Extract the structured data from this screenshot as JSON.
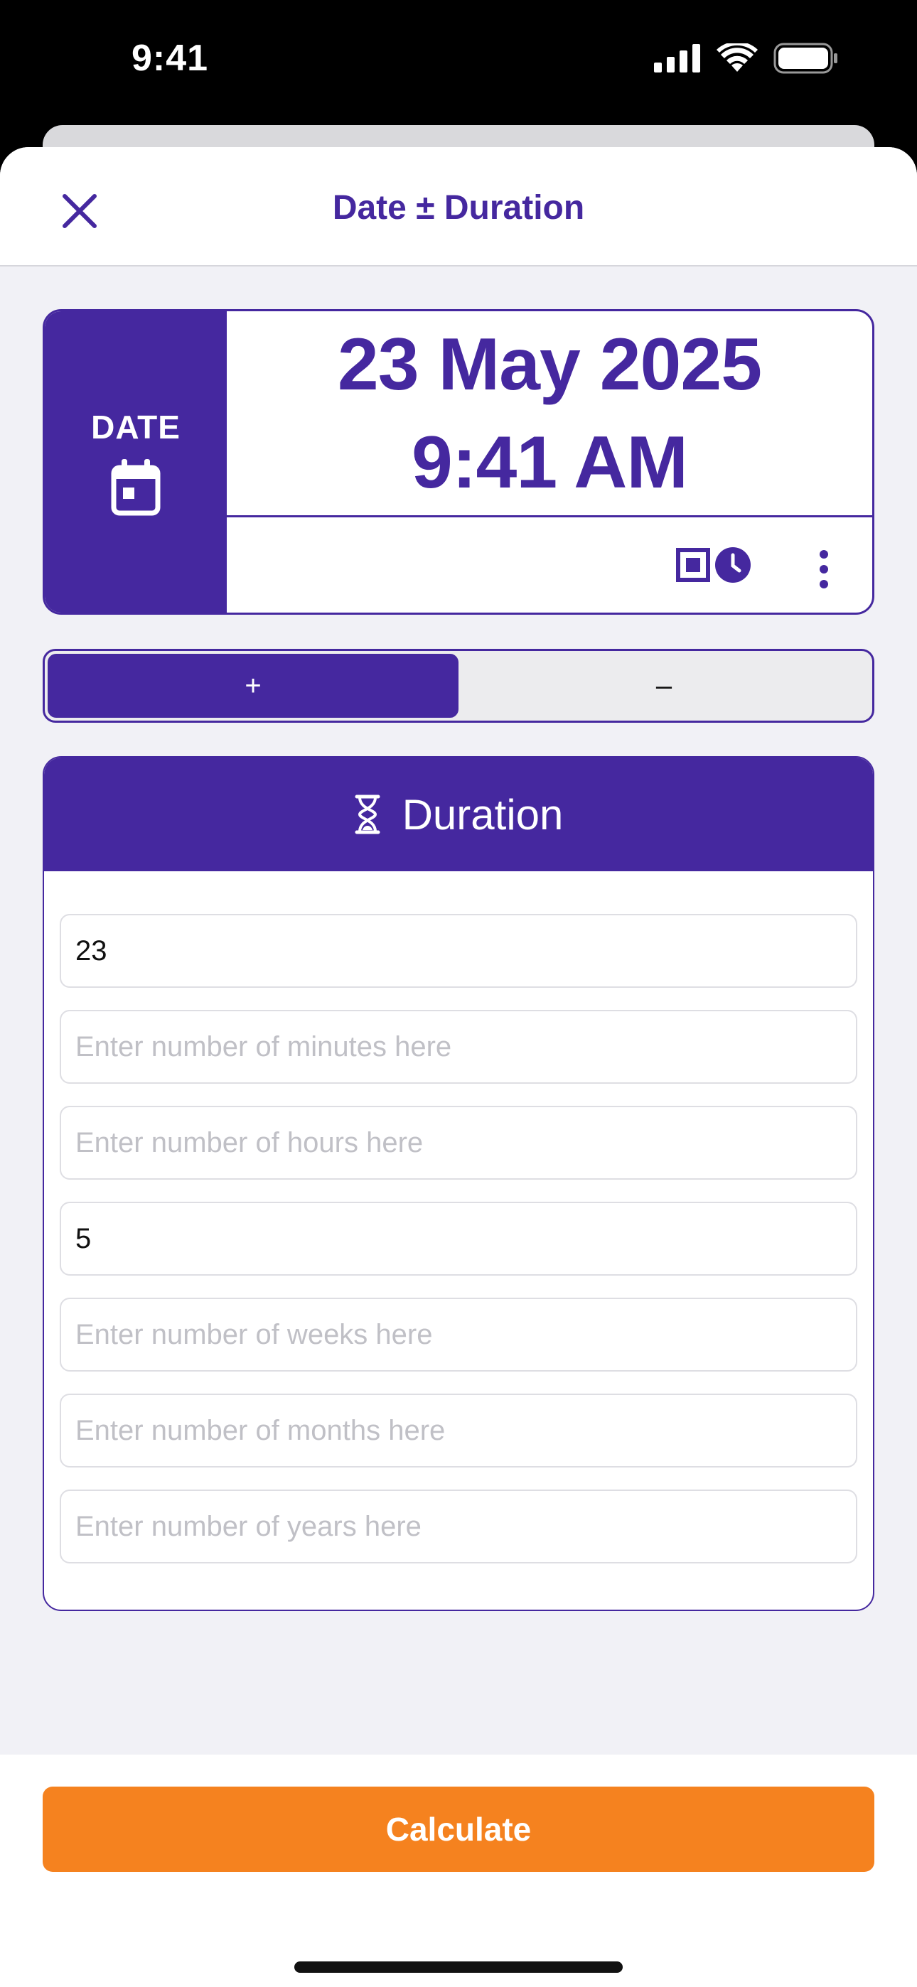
{
  "status_bar": {
    "time": "9:41"
  },
  "nav": {
    "title": "Date ± Duration"
  },
  "date_card": {
    "side_label": "DATE",
    "date_line": "23 May 2025",
    "time_line": "9:41 AM"
  },
  "operation": {
    "plus_label": "+",
    "minus_label": "–",
    "selected": "plus"
  },
  "duration": {
    "title": "Duration",
    "fields": [
      {
        "value": "23",
        "placeholder": ""
      },
      {
        "value": "",
        "placeholder": "Enter number of minutes here"
      },
      {
        "value": "",
        "placeholder": "Enter number of hours here"
      },
      {
        "value": "5",
        "placeholder": ""
      },
      {
        "value": "",
        "placeholder": "Enter number of weeks here"
      },
      {
        "value": "",
        "placeholder": "Enter number of months here"
      },
      {
        "value": "",
        "placeholder": "Enter number of years here"
      }
    ]
  },
  "actions": {
    "calculate_label": "Calculate"
  },
  "colors": {
    "primary": "#45289f",
    "accent": "#f5821f",
    "background": "#f1f1f6"
  },
  "icons": {
    "close": "close-icon",
    "calendar": "calendar-icon",
    "square": "stop-square-icon",
    "clock": "clock-icon",
    "more": "more-vertical-icon",
    "hourglass": "hourglass-icon"
  }
}
